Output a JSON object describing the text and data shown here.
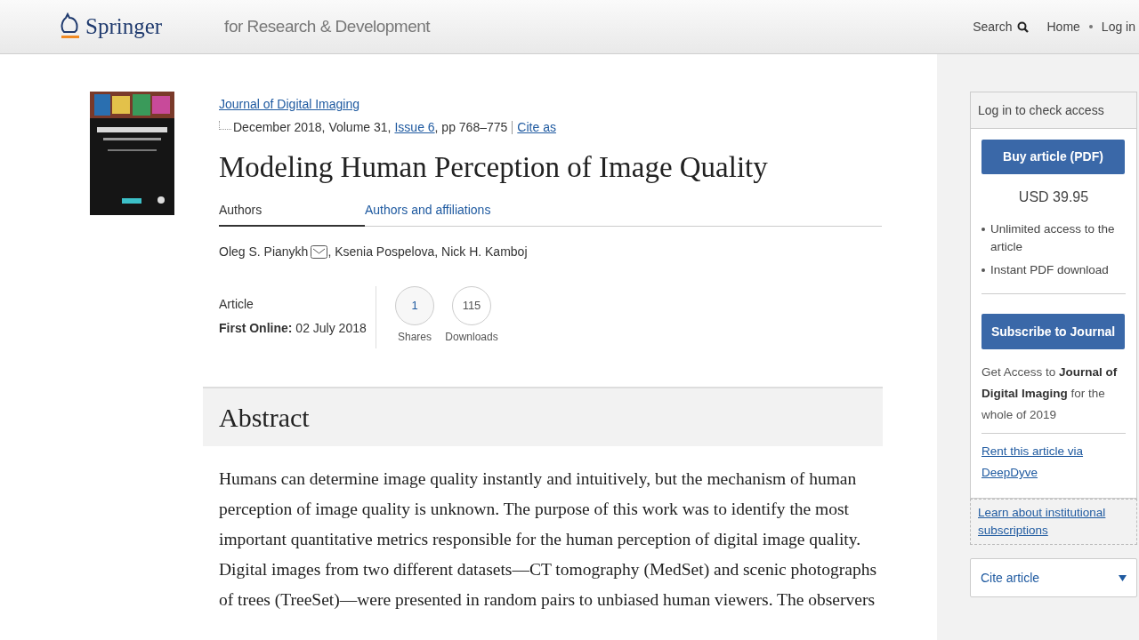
{
  "header": {
    "logo": "Springer",
    "tagline": "for Research & Development",
    "nav": [
      {
        "label": "Search",
        "kind": "search"
      },
      {
        "label": "Home",
        "kind": "link"
      },
      {
        "label": "Log in",
        "kind": "link"
      }
    ]
  },
  "citation": {
    "journal": "Journal of Digital Imaging",
    "date_volume": "December 2018, Volume 31,",
    "issue": "Issue 6",
    "pages": ", pp 768–775",
    "cite": "Cite as"
  },
  "title": "Modeling Human Perception of Image Quality",
  "tabs": [
    {
      "label": "Authors",
      "selected": true
    },
    {
      "label": "Authors and affiliations",
      "selected": false
    }
  ],
  "authors": [
    {
      "text": "Oleg S. Pianykh",
      "email": true
    },
    {
      "text": ", Ksenia Pospelova, Nick H. Kamboj",
      "email": false
    }
  ],
  "meta": {
    "type": "Article",
    "first_online_label": "First Online:",
    "first_online": "02 July 2018"
  },
  "metrics": [
    {
      "value": "1",
      "label": "Shares"
    },
    {
      "value": "115",
      "label": "Downloads"
    }
  ],
  "abstract": {
    "heading": "Abstract",
    "text": "Humans can determine image quality instantly and intuitively, but the mechanism of human perception of image quality is unknown. The purpose of this work was to identify the most important quantitative metrics responsible for the human perception of digital image quality. Digital images from two different datasets—CT tomography (MedSet) and scenic photographs of trees (TreeSet)—were presented in random pairs to unbiased human viewers. The observers"
  },
  "sidebar": {
    "access_header": "Log in to check access",
    "buy_button": "Buy article (PDF)",
    "price": "USD 39.95",
    "benefits": [
      "Unlimited access to the article",
      "Instant PDF download"
    ],
    "subscribe_button": "Subscribe to Journal",
    "subscribe_note": "Get Access to **Journal of Digital Imaging** for the whole of 2019",
    "rent_link": "Rent this article via DeepDyve",
    "institutional_link": "Learn about institutional subscriptions",
    "cite_dropdown": {
      "label": "Cite article",
      "expanded": false
    }
  }
}
